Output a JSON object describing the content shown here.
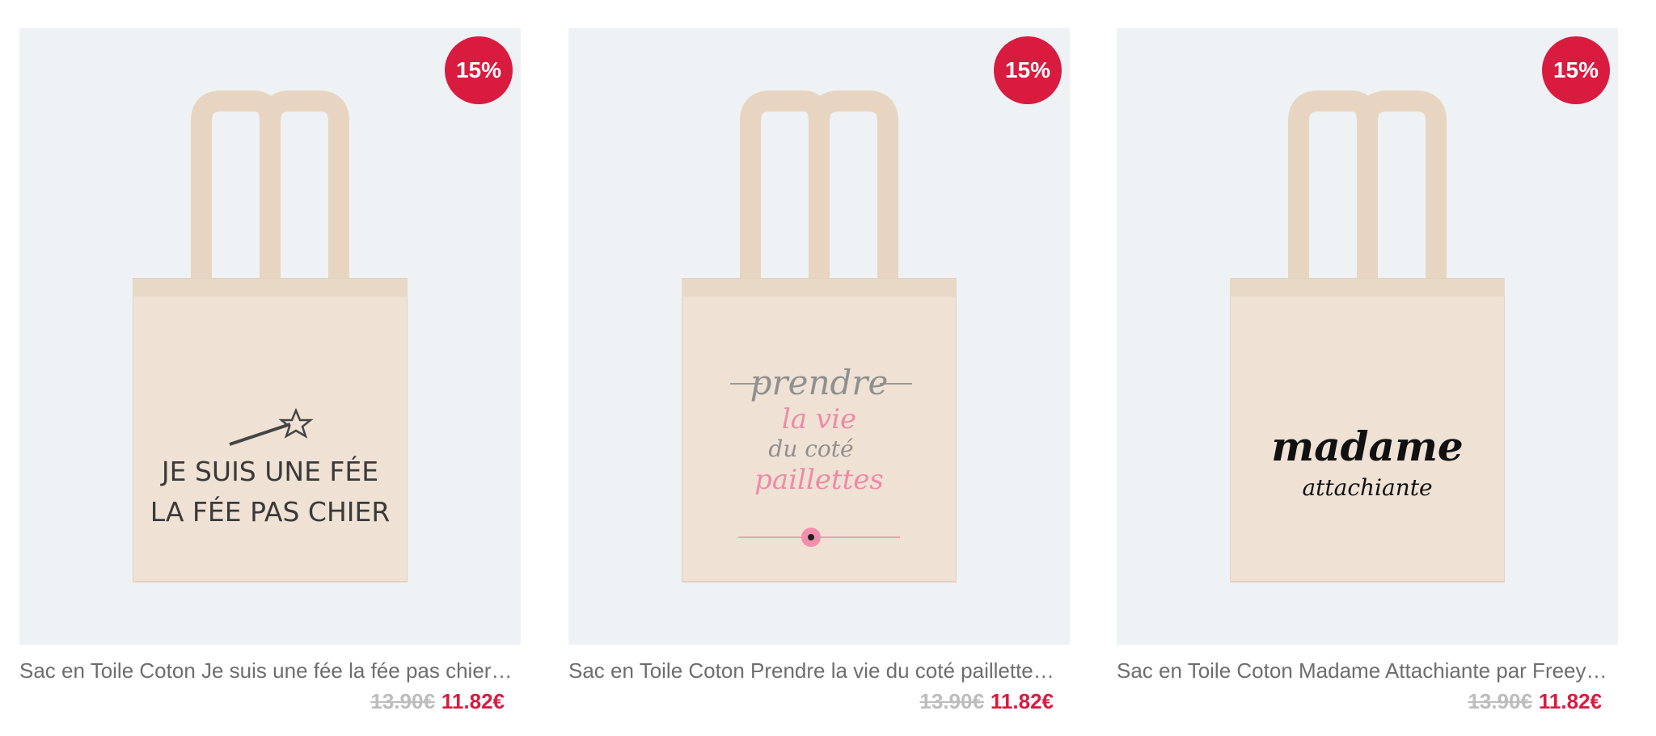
{
  "products": [
    {
      "badge": "15%",
      "title": "Sac en Toile Coton Je suis une fée la fée pas chier…",
      "old_price": "13.90€",
      "new_price": "11.82€",
      "print": {
        "line1": "JE SUIS UNE FÉE",
        "line2": "LA FÉE PAS CHIER"
      }
    },
    {
      "badge": "15%",
      "title": "Sac en Toile Coton Prendre la vie du coté paillette…",
      "old_price": "13.90€",
      "new_price": "11.82€",
      "print": {
        "line1": "prendre",
        "line2": "la vie",
        "line3": "du coté",
        "line4": "paillettes"
      }
    },
    {
      "badge": "15%",
      "title": "Sac en Toile Coton Madame Attachiante par Freey…",
      "old_price": "13.90€",
      "new_price": "11.82€",
      "print": {
        "line1": "madame",
        "line2": "attachiante"
      }
    }
  ],
  "colors": {
    "badge": "#d81b3f",
    "price_new": "#d81b3f",
    "price_old": "#bdbdbd",
    "card_bg": "#eef2f4",
    "canvas": "#efe2d4"
  }
}
